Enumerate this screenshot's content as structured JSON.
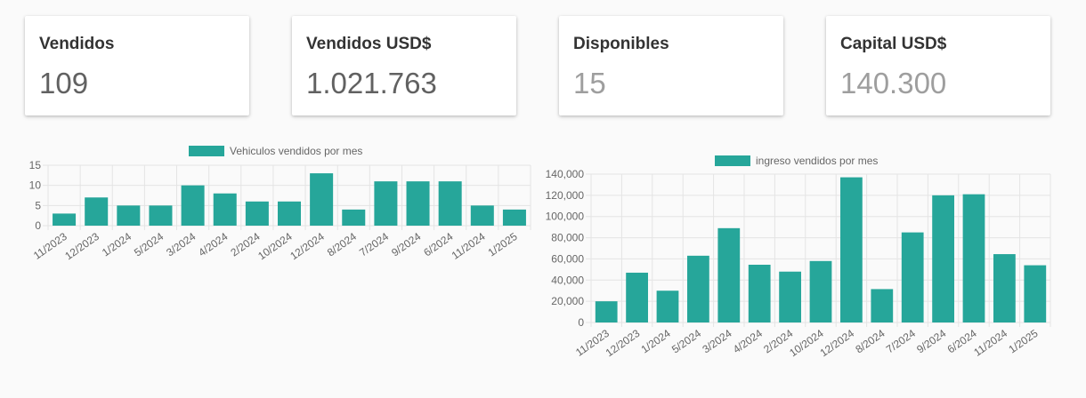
{
  "cards": [
    {
      "title": "Vendidos",
      "value": "109"
    },
    {
      "title": "Vendidos USD$",
      "value": "1.021.763"
    },
    {
      "title": "Disponibles",
      "value": "15"
    },
    {
      "title": "Capital USD$",
      "value": "140.300"
    }
  ],
  "colors": {
    "bar": "#26a69a",
    "grid": "#e4e4e4",
    "axis_text": "#666666",
    "value_dark": "#616161",
    "value_light": "#9e9e9e"
  },
  "chart_data": [
    {
      "type": "bar",
      "legend": "Vehiculos vendidos por mes",
      "categories": [
        "11/2023",
        "12/2023",
        "1/2024",
        "5/2024",
        "3/2024",
        "4/2024",
        "2/2024",
        "10/2024",
        "12/2024",
        "8/2024",
        "7/2024",
        "9/2024",
        "6/2024",
        "11/2024",
        "1/2025"
      ],
      "series": [
        {
          "name": "Vehiculos vendidos por mes",
          "values": [
            3,
            7,
            5,
            5,
            10,
            8,
            6,
            6,
            13,
            4,
            11,
            11,
            11,
            5,
            4
          ]
        }
      ],
      "ylim": [
        0,
        15
      ],
      "yticks": [
        "0",
        "5",
        "10",
        "15"
      ],
      "grid": true,
      "legend_position": "top"
    },
    {
      "type": "bar",
      "legend": "ingreso vendidos por mes",
      "categories": [
        "11/2023",
        "12/2023",
        "1/2024",
        "5/2024",
        "3/2024",
        "4/2024",
        "2/2024",
        "10/2024",
        "12/2024",
        "8/2024",
        "7/2024",
        "9/2024",
        "6/2024",
        "11/2024",
        "1/2025"
      ],
      "series": [
        {
          "name": "ingreso vendidos por mes",
          "values": [
            20000,
            47000,
            30000,
            63000,
            89000,
            54500,
            48000,
            58000,
            137000,
            31500,
            85000,
            120000,
            121000,
            64500,
            54000
          ]
        }
      ],
      "ylim": [
        0,
        140000
      ],
      "yticks": [
        "0",
        "20,000",
        "40,000",
        "60,000",
        "80,000",
        "100,000",
        "120,000",
        "140,000"
      ],
      "grid": true,
      "legend_position": "top"
    }
  ]
}
